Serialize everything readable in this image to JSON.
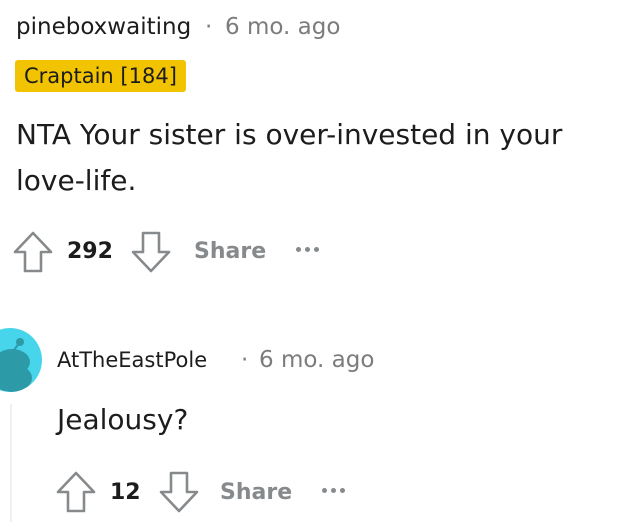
{
  "comment": {
    "author": "pineboxwaiting",
    "separator": "·",
    "time": "6 mo. ago",
    "flair": "Craptain [184]",
    "flair_color": "#f2c300",
    "body": "NTA Your sister is over-invested in your love-life.",
    "vote_count": "292",
    "share_label": "Share",
    "upvote_icon": "upvote-arrow-icon",
    "downvote_icon": "downvote-arrow-icon",
    "more_icon": "more-options-icon"
  },
  "reply": {
    "author": "AtTheEastPole",
    "separator": "·",
    "time": "6 mo. ago",
    "body": "Jealousy?",
    "vote_count": "12",
    "share_label": "Share",
    "avatar_color": "#46d5ea"
  }
}
